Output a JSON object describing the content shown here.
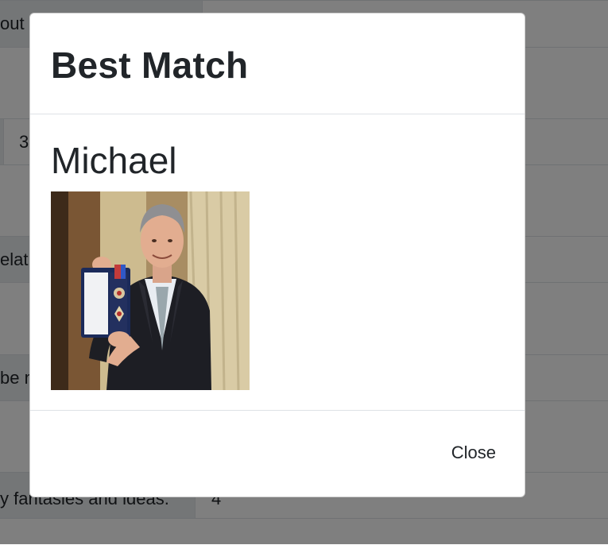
{
  "background_table": {
    "rows": [
      {
        "label": "out",
        "value": ""
      },
      {
        "label": "",
        "value": ""
      },
      {
        "label": "",
        "value": "3"
      },
      {
        "label": "",
        "value": ""
      },
      {
        "label": "elat",
        "value": ""
      },
      {
        "label": "",
        "value": ""
      },
      {
        "label": "be m",
        "value": ""
      },
      {
        "label": "",
        "value": ""
      },
      {
        "label": "y fantasies and ideas.",
        "value": "4"
      }
    ]
  },
  "modal": {
    "title": "Best Match",
    "match_name": "Michael",
    "photo_icon": "person-photo",
    "close_label": "Close"
  }
}
